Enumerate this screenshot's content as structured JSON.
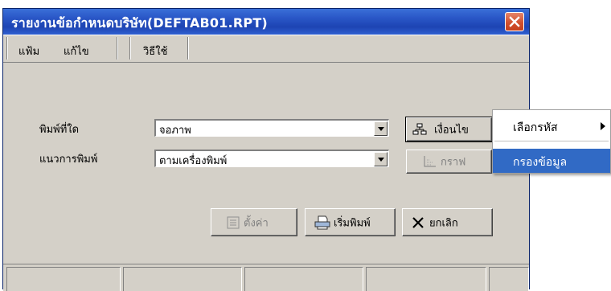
{
  "window": {
    "title": "รายงานข้อกำหนดบริษัท(DEFTAB01.RPT)"
  },
  "menu": {
    "items": [
      {
        "label": "แฟ้ม"
      },
      {
        "label": "แก้ไข"
      },
      {
        "label": "วิธีใช้"
      }
    ]
  },
  "form": {
    "print_to": {
      "label": "พิมพ์ที่ใด",
      "value": "จอภาพ"
    },
    "orientation": {
      "label": "แนวการพิมพ์",
      "value": "ตามเครื่องพิมพ์"
    }
  },
  "buttons": {
    "condition": {
      "label": "เงื่อนไข",
      "icon": "hierarchy-icon"
    },
    "graph": {
      "label": "กราฟ",
      "icon": "graph-icon"
    },
    "settings": {
      "label": "ตั้งค่า",
      "icon": "settings-icon"
    },
    "start_print": {
      "label": "เริ่มพิมพ์",
      "icon": "printer-icon"
    },
    "cancel": {
      "label": "ยกเลิก",
      "icon": "close-x-icon"
    }
  },
  "popup_menu": {
    "items": [
      {
        "label": "เลือกรหัส",
        "has_submenu": true
      },
      {
        "label": "กรองข้อมูล",
        "selected": true
      }
    ]
  },
  "colors": {
    "title_bar": "#2a57c7",
    "selection": "#316ac5",
    "dialog_bg": "#d4d0c8"
  }
}
